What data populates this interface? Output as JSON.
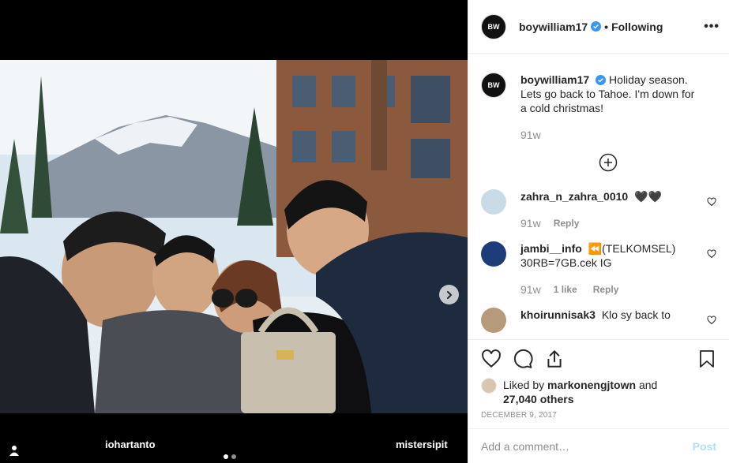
{
  "header": {
    "username": "boywilliam17",
    "avatar_text": "BW",
    "follow_state": "Following",
    "more_label": "•••"
  },
  "caption": {
    "username": "boywilliam17",
    "text": "Holiday season. Lets go back to Tahoe. I'm down for a cold christmas!",
    "time": "91w"
  },
  "comments": [
    {
      "username": "zahra_n_zahra_0010",
      "text": "🖤🖤",
      "time": "91w",
      "likes": "",
      "reply": "Reply",
      "avatar_color": "#c9dbe6"
    },
    {
      "username": "jambi__info",
      "text": "⏪(TELKOMSEL) 30RB=7GB.cek IG",
      "time": "91w",
      "likes": "1 like",
      "reply": "Reply",
      "avatar_color": "#1d3d7a"
    },
    {
      "username": "khoirunnisak3",
      "text": "Klo sy back to",
      "time": "",
      "likes": "",
      "reply": "",
      "avatar_color": "#b79a7a"
    }
  ],
  "media": {
    "tags": [
      "iohartanto",
      "mistersipit"
    ],
    "carousel_index": 1,
    "carousel_count": 2
  },
  "likes": {
    "liked_by_prefix": "Liked by",
    "liked_by_user": "markonengjtown",
    "and": "and",
    "count": "27,040 others"
  },
  "date": "DECEMBER 9, 2017",
  "add_comment": {
    "placeholder": "Add a comment…",
    "post_label": "Post"
  },
  "icons": {
    "verified": "verified-badge-icon",
    "like": "heart-icon",
    "comment": "comment-icon",
    "share": "share-icon",
    "save": "bookmark-icon",
    "load_more": "plus-circle-icon",
    "next": "chevron-right-icon",
    "tagged_people": "user-tag-icon"
  },
  "colors": {
    "verified_blue": "#3897f0",
    "post_button_disabled": "#b2dffc",
    "secondary_text": "#8e8e8e"
  }
}
